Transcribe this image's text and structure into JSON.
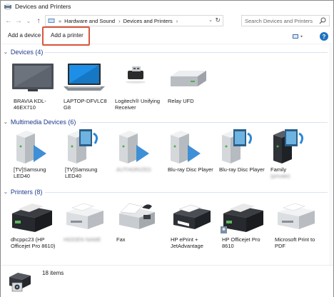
{
  "window": {
    "title": "Devices and Printers"
  },
  "nav": {
    "back": "←",
    "forward": "→",
    "recent": "⌄",
    "up": "↑"
  },
  "address": {
    "prefix": "«",
    "segments": [
      "Hardware and Sound",
      "Devices and Printers"
    ],
    "separator": "›"
  },
  "search": {
    "placeholder": "Search Devices and Printers"
  },
  "toolbar": {
    "add_device": "Add a device",
    "add_printer": "Add a printer",
    "help": "?"
  },
  "groups": [
    {
      "title": "Devices (4)",
      "items": [
        {
          "label": "BRAVIA KDL-46EX710",
          "icon": "tv-icon"
        },
        {
          "label": "LAPTOP-DFVLC8 G8",
          "icon": "laptop-icon"
        },
        {
          "label": "Logitech® Unifying Receiver",
          "icon": "usb-receiver-icon"
        },
        {
          "label": "Relay UFD",
          "icon": "drive-icon"
        }
      ]
    },
    {
      "title": "Multimedia Devices (6)",
      "items": [
        {
          "label": "[TV]Samsung LED40",
          "icon": "media-server-icon"
        },
        {
          "label": "[TV]Samsung LED40",
          "icon": "media-server-icon"
        },
        {
          "label": "AUTHORIZED",
          "icon": "media-server-icon",
          "blurred": true
        },
        {
          "label": "Blu-ray Disc Player",
          "icon": "media-server-icon"
        },
        {
          "label": "Blu-ray Disc Player",
          "icon": "media-server-icon"
        },
        {
          "label": "Family",
          "sublabel": "(private)",
          "icon": "media-server-icon"
        }
      ]
    },
    {
      "title": "Printers (8)",
      "items": [
        {
          "label": "dhcppc23 (HP Officejet Pro 8610)",
          "icon": "printer-icon"
        },
        {
          "label": "HIDDEN NAME",
          "icon": "printer-icon",
          "blurred": true
        },
        {
          "label": "Fax",
          "icon": "fax-icon"
        },
        {
          "label": "HP ePrint + JetAdvantage",
          "icon": "printer-icon"
        },
        {
          "label": "HP Officejet Pro 8610",
          "icon": "printer-icon"
        },
        {
          "label": "Microsoft Print to PDF",
          "icon": "printer-icon"
        }
      ]
    }
  ],
  "status": {
    "count": "18 items"
  },
  "colors": {
    "accent": "#1e73be",
    "highlight": "#d9573c",
    "group_title": "#1e3a8a"
  }
}
